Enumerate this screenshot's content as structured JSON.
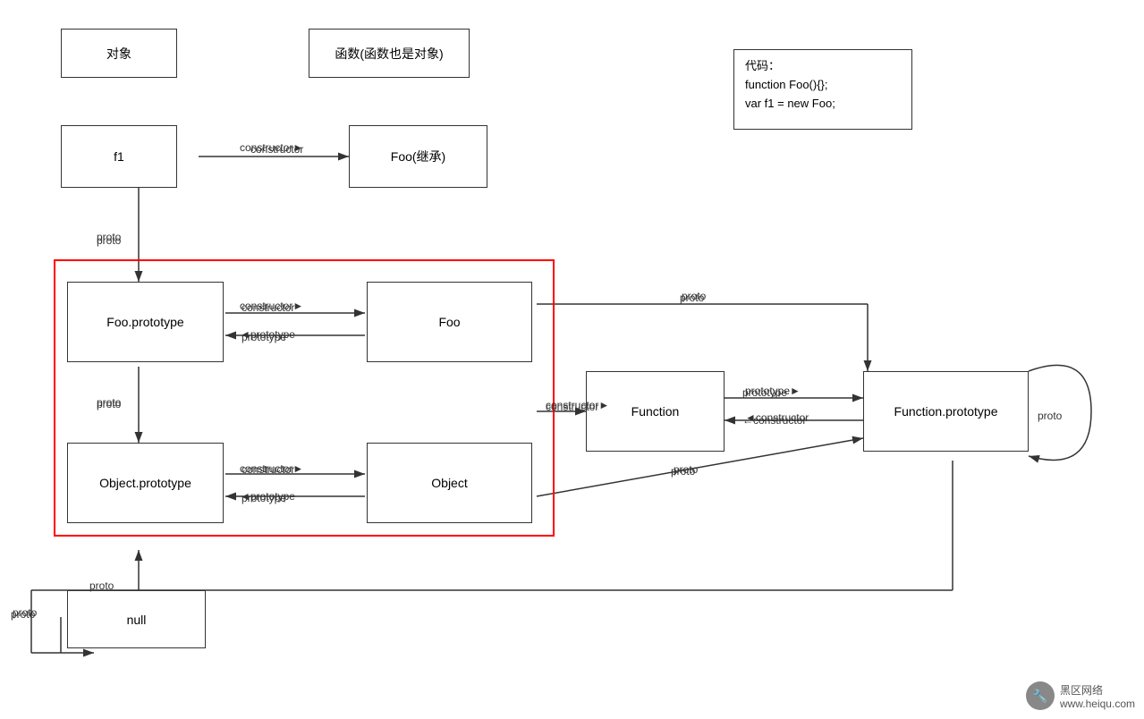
{
  "boxes": {
    "object_label": "对象",
    "function_label": "函数(函数也是对象)",
    "f1_label": "f1",
    "foo_inherit_label": "Foo(继承)",
    "foo_prototype_label": "Foo.prototype",
    "foo_label": "Foo",
    "object_prototype_label": "Object.prototype",
    "object_main_label": "Object",
    "function_main_label": "Function",
    "function_prototype_label": "Function.prototype",
    "null_label": "null"
  },
  "code": {
    "line1": "代码：",
    "line2": "function Foo(){};",
    "line3": "var  f1 = new Foo;"
  },
  "labels": {
    "constructor1": "constructor",
    "constructor2": "constructor",
    "constructor3": "constructor",
    "constructor4": "constructor",
    "prototype1": "prototype",
    "prototype2": "prototype",
    "prototype3": "prototype",
    "proto1": "proto",
    "proto2": "proto",
    "proto3": "proto",
    "proto4": "proto",
    "proto5": "proto",
    "proto6": "proto"
  },
  "watermark": {
    "site": "www.heiqu.com",
    "brand": "黑区网络"
  }
}
